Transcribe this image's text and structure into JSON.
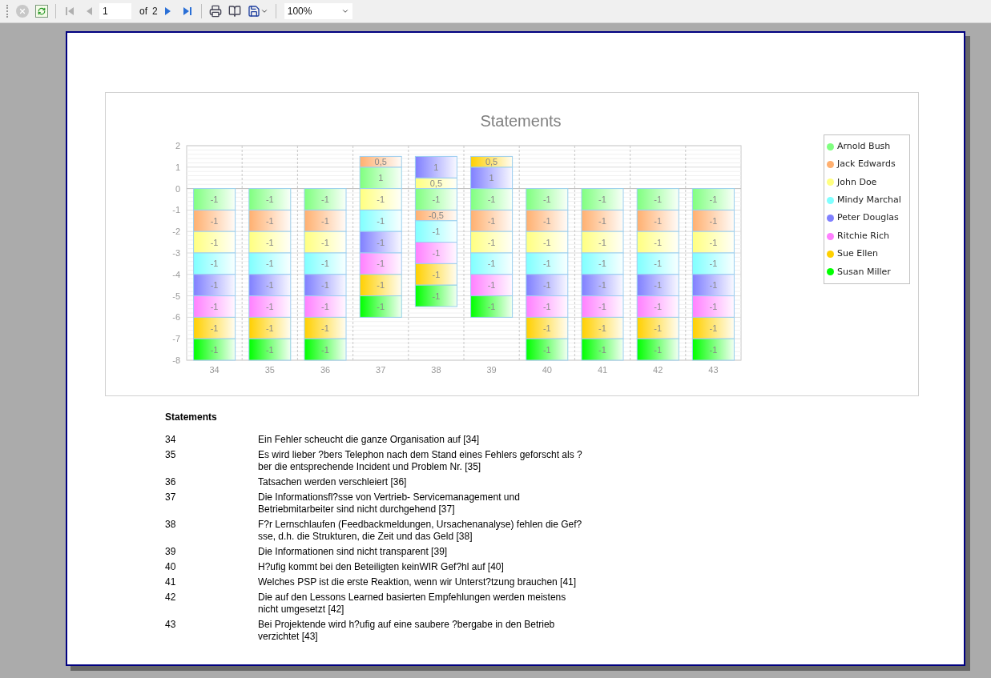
{
  "toolbar": {
    "buttons_left": [
      {
        "kind": "stop",
        "disabled": true
      },
      {
        "kind": "refresh",
        "disabled": false
      },
      {
        "kind": "first",
        "disabled": true
      },
      {
        "kind": "previous",
        "disabled": true
      }
    ],
    "page_field": {
      "value": "1"
    },
    "of_label": "of",
    "total_pages": "2",
    "buttons_right": [
      {
        "kind": "next",
        "disabled": false
      },
      {
        "kind": "last",
        "disabled": false
      },
      {
        "kind": "print",
        "disabled": false
      },
      {
        "kind": "page_setup",
        "disabled": false
      },
      {
        "kind": "save",
        "disabled": false
      }
    ],
    "zoom": {
      "value": "100%"
    }
  },
  "chart": {
    "chart_data": {
      "type": "bar",
      "title": "Statements",
      "stacked": true,
      "grid": true,
      "categories": [
        "34",
        "35",
        "36",
        "37",
        "38",
        "39",
        "40",
        "41",
        "42",
        "43"
      ],
      "ylim": [
        -8,
        2
      ],
      "yticks": [
        -8,
        -7,
        -6,
        -5,
        -4,
        -3,
        -2,
        -1,
        0,
        1,
        2
      ],
      "series": [
        {
          "name": "Arnold Bush",
          "color": "#80ff80",
          "values": [
            -1,
            -1,
            -1,
            1,
            -1,
            -1,
            -1,
            -1,
            -1,
            -1
          ],
          "value_labels": [
            "-1",
            "-1",
            "-1",
            "1",
            "-1",
            "-1",
            "-1",
            "-1",
            "-1",
            "-1"
          ]
        },
        {
          "name": "Jack Edwards",
          "color": "#ffb070",
          "values": [
            -1,
            -1,
            -1,
            0.5,
            -0.5,
            -1,
            -1,
            -1,
            -1,
            -1
          ],
          "value_labels": [
            "-1",
            "-1",
            "-1",
            "0,5",
            "-0,5",
            "-1",
            "-1",
            "-1",
            "-1",
            "-1"
          ]
        },
        {
          "name": "John Doe",
          "color": "#ffff80",
          "values": [
            -1,
            -1,
            -1,
            -1,
            0.5,
            -1,
            -1,
            -1,
            -1,
            -1
          ],
          "value_labels": [
            "-1",
            "-1",
            "-1",
            "-1",
            "0,5",
            "-1",
            "-1",
            "-1",
            "-1",
            "-1"
          ]
        },
        {
          "name": "Mindy Marchal",
          "color": "#80ffff",
          "values": [
            -1,
            -1,
            -1,
            -1,
            -1,
            -1,
            -1,
            -1,
            -1,
            -1
          ],
          "value_labels": [
            "-1",
            "-1",
            "-1",
            "-1",
            "-1",
            "-1",
            "-1",
            "-1",
            "-1",
            "-1"
          ]
        },
        {
          "name": "Peter Douglas",
          "color": "#8080ff",
          "values": [
            -1,
            -1,
            -1,
            -1,
            1,
            1,
            -1,
            -1,
            -1,
            -1
          ],
          "value_labels": [
            "-1",
            "-1",
            "-1",
            "-1",
            "1",
            "1",
            "-1",
            "-1",
            "-1",
            "-1"
          ]
        },
        {
          "name": "Ritchie Rich",
          "color": "#ff80ff",
          "values": [
            -1,
            -1,
            -1,
            -1,
            -1,
            -1,
            -1,
            -1,
            -1,
            -1
          ],
          "value_labels": [
            "-1",
            "-1",
            "-1",
            "-1",
            "-1",
            "-1",
            "-1",
            "-1",
            "-1",
            "-1"
          ]
        },
        {
          "name": "Sue Ellen",
          "color": "#ffd000",
          "values": [
            -1,
            -1,
            -1,
            -1,
            -1,
            0.5,
            -1,
            -1,
            -1,
            -1
          ],
          "value_labels": [
            "-1",
            "-1",
            "-1",
            "-1",
            "-1",
            "0,5",
            "-1",
            "-1",
            "-1",
            "-1"
          ]
        },
        {
          "name": "Susan Miller",
          "color": "#00ff00",
          "values": [
            -1,
            -1,
            -1,
            -1,
            -1,
            -1,
            -1,
            -1,
            -1,
            -1
          ],
          "value_labels": [
            "-1",
            "-1",
            "-1",
            "-1",
            "-1",
            "-1",
            "-1",
            "-1",
            "-1",
            "-1"
          ]
        }
      ]
    }
  },
  "statements": {
    "heading": "Statements",
    "items": [
      {
        "number": "34",
        "lines": [
          "Ein Fehler scheucht die ganze Organisation auf [34]"
        ]
      },
      {
        "number": "35",
        "lines": [
          "Es wird lieber ?bers Telephon nach dem Stand eines Fehlers geforscht als ?",
          "ber die entsprechende Incident und Problem Nr. [35]"
        ]
      },
      {
        "number": "36",
        "lines": [
          "Tatsachen werden verschleiert [36]"
        ]
      },
      {
        "number": "37",
        "lines": [
          "Die Informationsfl?sse von Vertrieb- Servicemanagement und",
          "Betriebmitarbeiter sind nicht durchgehend [37]"
        ]
      },
      {
        "number": "38",
        "lines": [
          "F?r Lernschlaufen (Feedbackmeldungen, Ursachenanalyse) fehlen die Gef?",
          "sse, d.h. die Strukturen, die Zeit und das Geld [38]"
        ]
      },
      {
        "number": "39",
        "lines": [
          "Die Informationen sind nicht transparent [39]"
        ]
      },
      {
        "number": "40",
        "lines": [
          "H?ufig kommt bei den Beteiligten keinWIR Gef?hl auf [40]"
        ]
      },
      {
        "number": "41",
        "lines": [
          "Welches PSP ist die erste Reaktion, wenn wir Unterst?tzung brauchen [41]"
        ]
      },
      {
        "number": "42",
        "lines": [
          "Die auf den Lessons Learned basierten Empfehlungen werden meistens",
          "nicht umgesetzt [42]"
        ]
      },
      {
        "number": "43",
        "lines": [
          "Bei Projektende wird h?ufig auf eine saubere ?bergabe in den Betrieb",
          "verzichtet [43]"
        ]
      }
    ]
  }
}
